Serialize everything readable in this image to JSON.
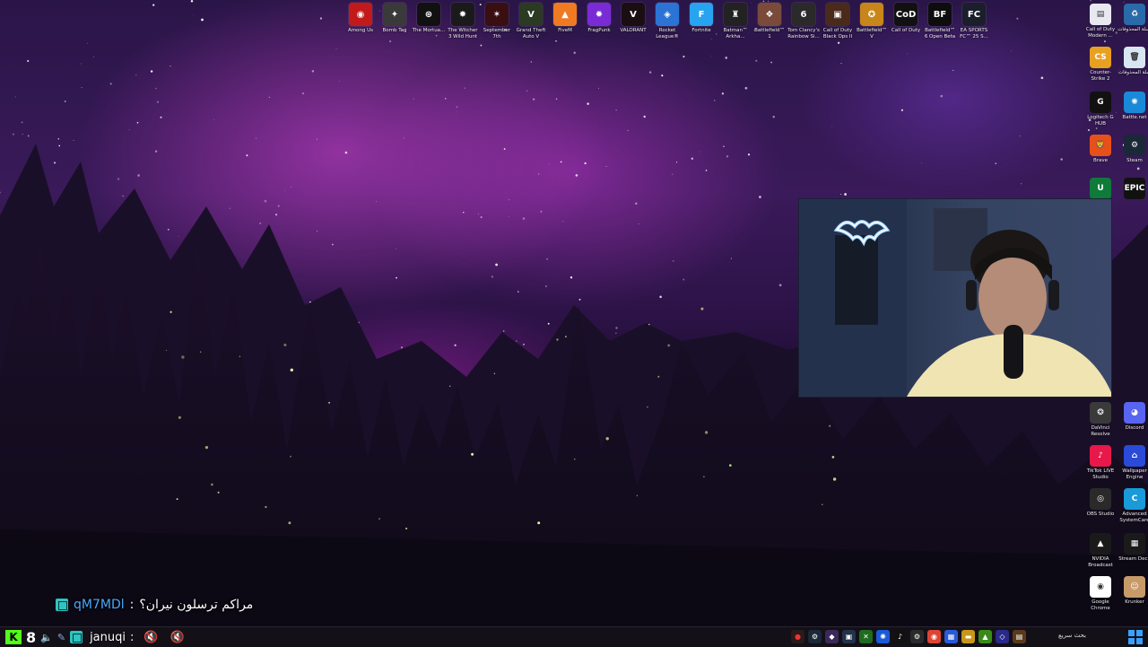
{
  "desktop_icons_top": [
    {
      "label": "Among Us",
      "color": "#c21a1a",
      "glyph": "◉"
    },
    {
      "label": "Bomb Tag",
      "color": "#3a3a3a",
      "glyph": "✦"
    },
    {
      "label": "The Mortua...",
      "color": "#111111",
      "glyph": "⊛"
    },
    {
      "label": "The Witcher 3 Wild Hunt",
      "color": "#1a1a1a",
      "glyph": "✸"
    },
    {
      "label": "September 7th",
      "color": "#3a0f12",
      "glyph": "✶"
    },
    {
      "label": "Grand Theft Auto V",
      "color": "#2b3a22",
      "glyph": "V"
    },
    {
      "label": "FiveM",
      "color": "#f07a22",
      "glyph": "▲"
    },
    {
      "label": "FragPunk",
      "color": "#7a2bd6",
      "glyph": "✹"
    },
    {
      "label": "VALORANT",
      "color": "#1a0e12",
      "glyph": "V"
    },
    {
      "label": "Rocket League®",
      "color": "#2b74d6",
      "glyph": "◈"
    },
    {
      "label": "Fortnite",
      "color": "#28a3f0",
      "glyph": "F"
    },
    {
      "label": "Batman™ Arkha...",
      "color": "#222222",
      "glyph": "♜"
    },
    {
      "label": "Battlefield™ 1",
      "color": "#7a4a3a",
      "glyph": "❖"
    },
    {
      "label": "Tom Clancy's Rainbow Si...",
      "color": "#2a2a2a",
      "glyph": "6"
    },
    {
      "label": "Call of Duty Black Ops II",
      "color": "#4a2a1a",
      "glyph": "▣"
    },
    {
      "label": "Battlefield™ V",
      "color": "#c8861a",
      "glyph": "✪"
    },
    {
      "label": "Call of Duty",
      "color": "#111111",
      "glyph": "CoD"
    },
    {
      "label": "Battlefield™ 6 Open Beta",
      "color": "#0d0d0d",
      "glyph": "BF"
    },
    {
      "label": "EA SPORTS FC™ 25 S...",
      "color": "#1a1f2b",
      "glyph": "FC"
    }
  ],
  "desktop_icons_right": [
    {
      "label": "Call of Duty Modern ...",
      "color": "#e8e8f0",
      "glyph": "▤"
    },
    {
      "label": "سلة المحذوفات",
      "color": "#d8e6f2",
      "glyph": "🗑"
    },
    {
      "label": "Counter-Strike 2",
      "color": "#e8a020",
      "glyph": "CS"
    },
    {
      "label": "إسلة المحذوفات",
      "color": "#2a6aa8",
      "glyph": "♻"
    },
    {
      "label": "Logitech G HUB",
      "color": "#111111",
      "glyph": "G"
    },
    {
      "label": "Battle.net",
      "color": "#1a8ad8",
      "glyph": "✺"
    },
    {
      "label": "Brave",
      "color": "#e8501a",
      "glyph": "🦁"
    },
    {
      "label": "Steam",
      "color": "#1b2838",
      "glyph": "⚙"
    },
    {
      "label": "",
      "color": "#0f7a3a",
      "glyph": "U"
    },
    {
      "label": "",
      "color": "#111111",
      "glyph": "EPIC"
    },
    {
      "label": "DaVinci Resolve",
      "color": "#3a3a3a",
      "glyph": "❂"
    },
    {
      "label": "Discord",
      "color": "#5865f2",
      "glyph": "◕"
    },
    {
      "label": "TikTok LIVE Studio",
      "color": "#e8184a",
      "glyph": "♪"
    },
    {
      "label": "Wallpaper Engine",
      "color": "#2a4ad8",
      "glyph": "⌂"
    },
    {
      "label": "OBS Studio",
      "color": "#2a2a2a",
      "glyph": "◎"
    },
    {
      "label": "Advanced SystemCare",
      "color": "#1a9ad8",
      "glyph": "C"
    },
    {
      "label": "NVIDIA Broadcast",
      "color": "#1a1a1a",
      "glyph": "▲"
    },
    {
      "label": "Stream Deck",
      "color": "#1a1a1a",
      "glyph": "▦"
    },
    {
      "label": "Google Chrome",
      "color": "#ffffff",
      "glyph": "◉"
    },
    {
      "label": "Krunker",
      "color": "#c89a6a",
      "glyph": "☺"
    }
  ],
  "chat": {
    "line1": {
      "user": "qM7MDl",
      "separator": ":",
      "message": "مراكم ترسلون نيران؟"
    },
    "line2": {
      "user": "januqi",
      "separator": ":"
    }
  },
  "taskbar": {
    "count": "8",
    "search_label": "بحث سريع"
  },
  "colors": {
    "accent_blue": "#4aa8ff",
    "badge_teal": "#2ec4c0",
    "kick_green": "#53fc18"
  }
}
